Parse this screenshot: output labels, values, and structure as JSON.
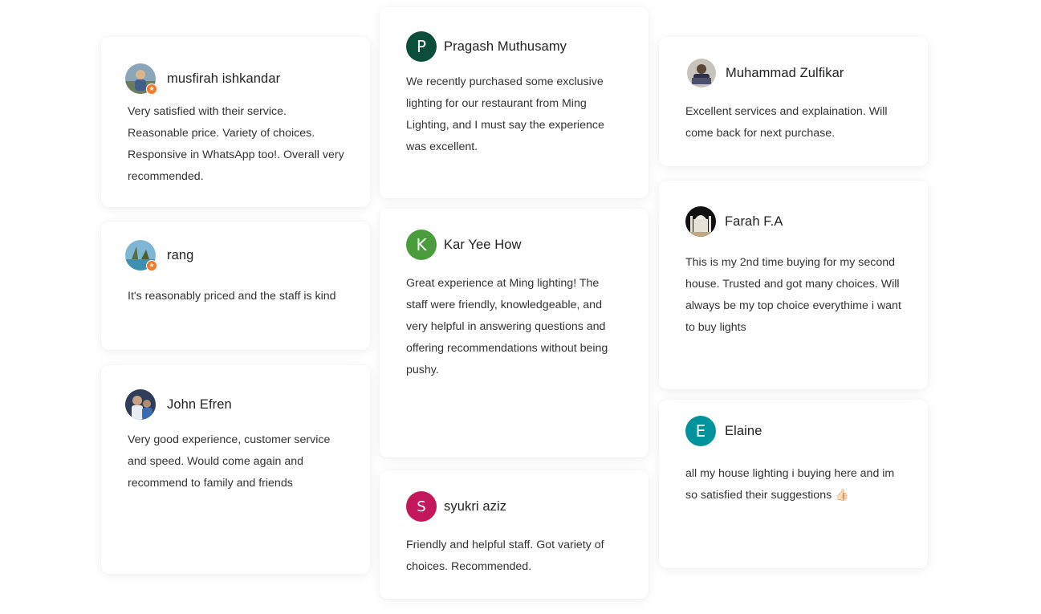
{
  "reviews": [
    {
      "name": "musfirah ishkandar",
      "text": "Very satisfied with their service. Reasonable price. Variety of choices. Responsive in WhatsApp too!. Overall very recommended.",
      "avatar": "photo"
    },
    {
      "name": "rang",
      "text": "It's reasonably priced and the staff is kind",
      "avatar": "photo"
    },
    {
      "name": "John Efren",
      "text": "Very good experience, customer service and speed. Would come again and recommend to family and friends",
      "avatar": "photo"
    },
    {
      "name": "Pragash Muthusamy",
      "initial": "P",
      "color": "#0b4d3b",
      "text": "We recently purchased some exclusive lighting for our restaurant from Ming Lighting, and I must say the experience was excellent."
    },
    {
      "name": "Kar Yee How",
      "initial": "K",
      "color": "#4a9c3c",
      "text": "Great experience at Ming lighting! The staff were friendly, knowledgeable, and very helpful in answering questions and offering recommendations without being pushy."
    },
    {
      "name": "syukri aziz",
      "initial": "S",
      "color": "#c2185b",
      "text": "Friendly and helpful staff. Got variety of choices. Recommended."
    },
    {
      "name": "Muhammad Zulfikar",
      "text": "Excellent services and explaination. Will come back for next purchase.",
      "avatar": "photo"
    },
    {
      "name": "Farah F.A",
      "text": "This is my 2nd time buying for my second house. Trusted and got many choices. Will always be my top choice everythime i want to buy lights",
      "avatar": "photo"
    },
    {
      "name": "Elaine",
      "initial": "E",
      "color": "#00939c",
      "text": "all my house lighting i buying here and im so satisfied their suggestions 👍🏻"
    }
  ]
}
